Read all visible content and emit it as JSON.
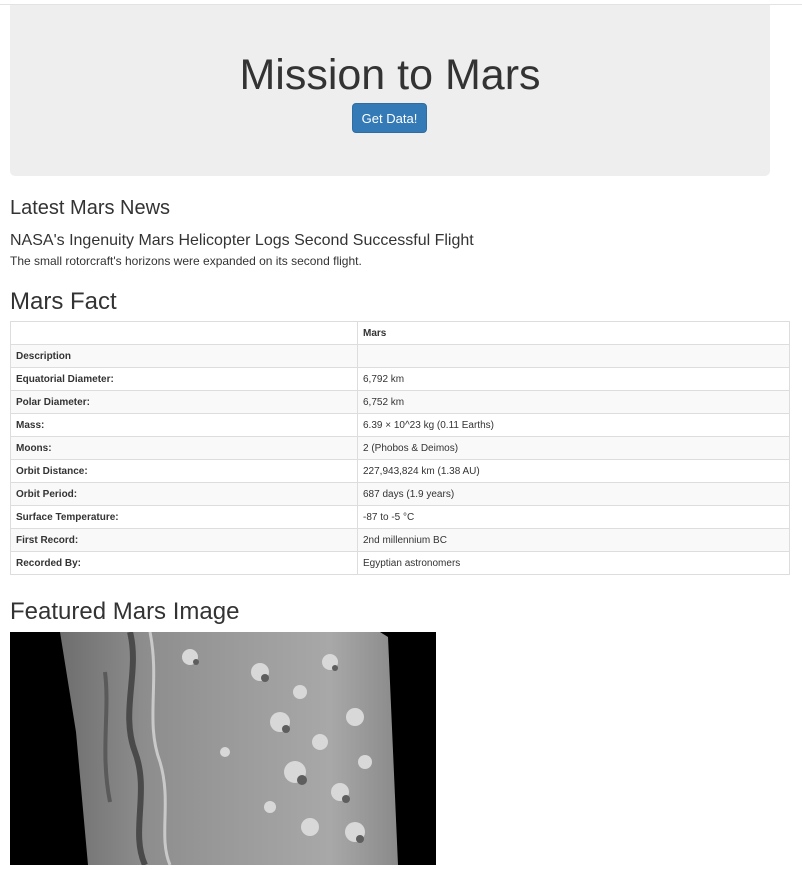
{
  "header": {
    "title": "Mission to Mars",
    "button_label": "Get Data!"
  },
  "news": {
    "heading": "Latest Mars News",
    "title": "NASA's Ingenuity Mars Helicopter Logs Second Successful Flight",
    "teaser": "The small rotorcraft's horizons were expanded on its second flight."
  },
  "facts": {
    "heading": "Mars Fact",
    "column_header": "Mars",
    "rows": [
      {
        "label": "Description",
        "value": ""
      },
      {
        "label": "Equatorial Diameter:",
        "value": "6,792 km"
      },
      {
        "label": "Polar Diameter:",
        "value": "6,752 km"
      },
      {
        "label": "Mass:",
        "value": "6.39 × 10^23 kg (0.11 Earths)"
      },
      {
        "label": "Moons:",
        "value": "2 (Phobos & Deimos)"
      },
      {
        "label": "Orbit Distance:",
        "value": "227,943,824 km (1.38 AU)"
      },
      {
        "label": "Orbit Period:",
        "value": "687 days (1.9 years)"
      },
      {
        "label": "Surface Temperature:",
        "value": "-87 to -5 °C"
      },
      {
        "label": "First Record:",
        "value": "2nd millennium BC"
      },
      {
        "label": "Recorded By:",
        "value": "Egyptian astronomers"
      }
    ]
  },
  "image": {
    "heading": "Featured Mars Image"
  },
  "colors": {
    "primary": "#337ab7",
    "jumbotron_bg": "#eeeeee",
    "text": "#333333"
  }
}
